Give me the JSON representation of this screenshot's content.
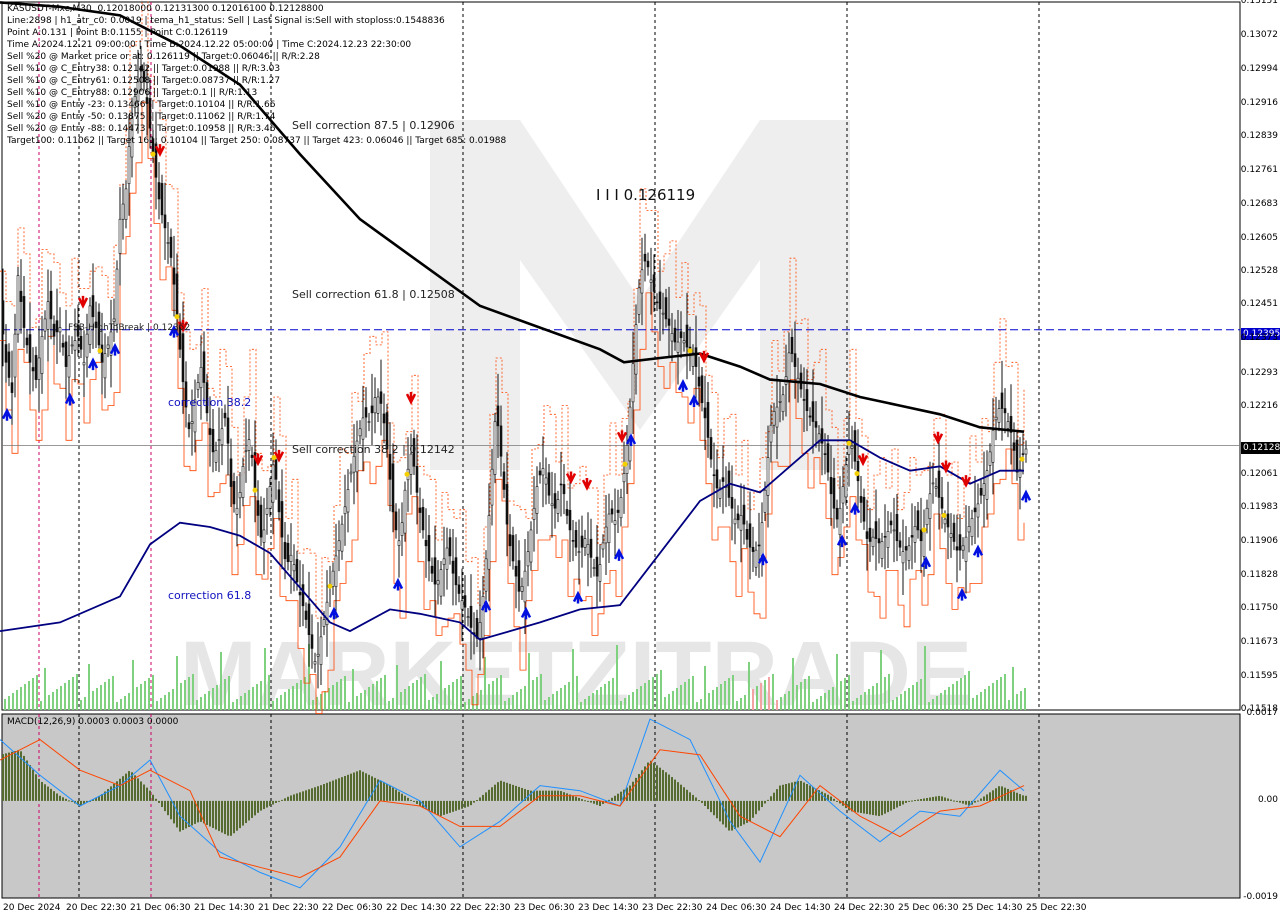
{
  "info_lines": [
    "KASUSDT-Mxc,M30  0.12018000 0.12131300 0.12016100 0.12128800",
    "Line:2898 | h1_atr_c0: 0.0019 | tema_h1_status: Sell | Last Signal is:Sell with stoploss:0.1548836",
    "Point A:0.131 | Point B:0.1155 | Point C:0.126119",
    "Time A:2024.12.21 09:00:00 | Time B:2024.12.22 05:00:00 | Time C:2024.12.23 22:30:00",
    "Sell %20 @ Market price or at: 0.126119 || Target:0.06046 || R/R:2.28",
    "Sell %10 @ C_Entry38: 0.12142 || Target:0.01988 || R/R:3.03",
    "Sell %10 @ C_Entry61: 0.12508 || Target:0.08737 || R/R:1.27",
    "Sell %10 @ C_Entry88: 0.12906 || Target:0.1 || R/R:1.13",
    "Sell %10 @ Entry -23: 0.13466 || Target:0.10104 || R/R:1.66",
    "Sell %20 @ Entry -50: 0.13875 || Target:0.11062 || R/R:1.74",
    "Sell %20 @ Entry -88: 0.14473 || Target:0.10958 || R/R:3.46",
    "Target100: 0.11062 || Target 161: 0.10104 || Target 250: 0.08737 || Target 423: 0.06046 || Target 685: 0.01988"
  ],
  "annotations": {
    "sell_correction_875": "Sell correction 87.5 | 0.12906",
    "sell_correction_618": "Sell correction 61.8 | 0.12508",
    "sell_correction_382": "Sell correction 38.2 | 0.12142",
    "high_to_break": "FSB-HighToBreak | 0.12352",
    "correction_382": "correction 38.2",
    "correction_618": "correction 61.8",
    "point_c": "I I I 0.126119"
  },
  "price_axis": [
    "0.13151",
    "0.13072",
    "0.12994",
    "0.12916",
    "0.12839",
    "0.12761",
    "0.12683",
    "0.12605",
    "0.12528",
    "0.12451",
    "0.12373",
    "0.12293",
    "0.12216",
    "0.12061",
    "0.11983",
    "0.11906",
    "0.11828",
    "0.11750",
    "0.11673",
    "0.11595",
    "0.11518"
  ],
  "price_boxes": {
    "high_to_break": "0.12395",
    "current": "0.12128"
  },
  "macd_axis": [
    "0.0017",
    "0.00",
    "-0.0019"
  ],
  "macd_title": "MACD(12,26,9) 0.0003 0.0003 0.0000",
  "time_axis": [
    "20 Dec 2024",
    "20 Dec 22:30",
    "21 Dec 06:30",
    "21 Dec 14:30",
    "21 Dec 22:30",
    "22 Dec 06:30",
    "22 Dec 14:30",
    "22 Dec 22:30",
    "23 Dec 06:30",
    "23 Dec 14:30",
    "23 Dec 22:30",
    "24 Dec 06:30",
    "24 Dec 14:30",
    "24 Dec 22:30",
    "25 Dec 06:30",
    "25 Dec 14:30",
    "25 Dec 22:30"
  ],
  "watermark": "MARKETZITRADE",
  "colors": {
    "bull": "#1a1a1a",
    "bear": "#1a1a1a",
    "ema_long": "#000000",
    "ema_short": "#000080",
    "orange": "#ff4500",
    "macd_hist": "#556b2f",
    "macd_line": "#1e90ff",
    "signal_line": "#ff4500",
    "level_line": "#0000cd"
  },
  "chart_data": {
    "type": "candlestick",
    "symbol": "KASUSDT-Mxc",
    "timeframe": "M30",
    "ylim": [
      0.11518,
      0.13151
    ],
    "key_points_y": [
      0.131,
      0.1155,
      0.126119
    ],
    "close_path": [
      [
        0,
        0.1245
      ],
      [
        6,
        0.1232
      ],
      [
        12,
        0.1225
      ],
      [
        18,
        0.1252
      ],
      [
        24,
        0.124
      ],
      [
        30,
        0.1232
      ],
      [
        36,
        0.1228
      ],
      [
        42,
        0.1238
      ],
      [
        48,
        0.1246
      ],
      [
        54,
        0.1238
      ],
      [
        60,
        0.124
      ],
      [
        66,
        0.1231
      ],
      [
        72,
        0.1236
      ],
      [
        78,
        0.1238
      ],
      [
        84,
        0.1232
      ],
      [
        90,
        0.1245
      ],
      [
        96,
        0.124
      ],
      [
        102,
        0.1232
      ],
      [
        108,
        0.1236
      ],
      [
        114,
        0.1242
      ],
      [
        120,
        0.1265
      ],
      [
        126,
        0.1272
      ],
      [
        130,
        0.1285
      ],
      [
        136,
        0.1295
      ],
      [
        142,
        0.13
      ],
      [
        148,
        0.129
      ],
      [
        154,
        0.1278
      ],
      [
        160,
        0.1268
      ],
      [
        166,
        0.1262
      ],
      [
        172,
        0.1255
      ],
      [
        178,
        0.124
      ],
      [
        184,
        0.1225
      ],
      [
        190,
        0.1215
      ],
      [
        196,
        0.1225
      ],
      [
        202,
        0.1232
      ],
      [
        208,
        0.1218
      ],
      [
        214,
        0.121
      ],
      [
        220,
        0.1215
      ],
      [
        226,
        0.122
      ],
      [
        232,
        0.12
      ],
      [
        238,
        0.1198
      ],
      [
        244,
        0.121
      ],
      [
        250,
        0.1215
      ],
      [
        256,
        0.12
      ],
      [
        262,
        0.119
      ],
      [
        268,
        0.12
      ],
      [
        274,
        0.121
      ],
      [
        280,
        0.1195
      ],
      [
        286,
        0.1185
      ],
      [
        292,
        0.1188
      ],
      [
        298,
        0.118
      ],
      [
        304,
        0.1175
      ],
      [
        310,
        0.1168
      ],
      [
        316,
        0.1162
      ],
      [
        322,
        0.117
      ],
      [
        328,
        0.1178
      ],
      [
        334,
        0.1185
      ],
      [
        340,
        0.1192
      ],
      [
        346,
        0.12
      ],
      [
        352,
        0.1208
      ],
      [
        358,
        0.1215
      ],
      [
        364,
        0.122
      ],
      [
        370,
        0.1218
      ],
      [
        376,
        0.1225
      ],
      [
        382,
        0.1222
      ],
      [
        388,
        0.121
      ],
      [
        394,
        0.1195
      ],
      [
        400,
        0.119
      ],
      [
        406,
        0.1205
      ],
      [
        412,
        0.1212
      ],
      [
        418,
        0.12
      ],
      [
        424,
        0.1192
      ],
      [
        430,
        0.1185
      ],
      [
        436,
        0.118
      ],
      [
        442,
        0.1185
      ],
      [
        448,
        0.119
      ],
      [
        454,
        0.1182
      ],
      [
        460,
        0.1178
      ],
      [
        466,
        0.1175
      ],
      [
        472,
        0.117
      ],
      [
        478,
        0.1168
      ],
      [
        484,
        0.118
      ],
      [
        490,
        0.12
      ],
      [
        496,
        0.1222
      ],
      [
        502,
        0.1208
      ],
      [
        508,
        0.1192
      ],
      [
        514,
        0.1185
      ],
      [
        520,
        0.1178
      ],
      [
        526,
        0.1185
      ],
      [
        532,
        0.1195
      ],
      [
        538,
        0.1205
      ],
      [
        544,
        0.1208
      ],
      [
        550,
        0.12
      ],
      [
        556,
        0.1198
      ],
      [
        562,
        0.1205
      ],
      [
        568,
        0.1195
      ],
      [
        574,
        0.119
      ],
      [
        580,
        0.1188
      ],
      [
        586,
        0.1192
      ],
      [
        592,
        0.1186
      ],
      [
        598,
        0.1182
      ],
      [
        604,
        0.1192
      ],
      [
        610,
        0.1198
      ],
      [
        616,
        0.1195
      ],
      [
        622,
        0.1202
      ],
      [
        628,
        0.1215
      ],
      [
        634,
        0.1235
      ],
      [
        640,
        0.1252
      ],
      [
        646,
        0.1256
      ],
      [
        652,
        0.125
      ],
      [
        658,
        0.1245
      ],
      [
        664,
        0.1243
      ],
      [
        670,
        0.124
      ],
      [
        676,
        0.1236
      ],
      [
        682,
        0.1238
      ],
      [
        688,
        0.1235
      ],
      [
        694,
        0.1234
      ],
      [
        700,
        0.1225
      ],
      [
        706,
        0.1218
      ],
      [
        712,
        0.1208
      ],
      [
        718,
        0.1202
      ],
      [
        724,
        0.1205
      ],
      [
        730,
        0.12
      ],
      [
        736,
        0.1195
      ],
      [
        742,
        0.1197
      ],
      [
        748,
        0.119
      ],
      [
        754,
        0.1188
      ],
      [
        760,
        0.119
      ],
      [
        766,
        0.1205
      ],
      [
        772,
        0.122
      ],
      [
        778,
        0.1222
      ],
      [
        784,
        0.1225
      ],
      [
        790,
        0.1236
      ],
      [
        796,
        0.123
      ],
      [
        802,
        0.1225
      ],
      [
        808,
        0.122
      ],
      [
        814,
        0.1218
      ],
      [
        820,
        0.1215
      ],
      [
        826,
        0.121
      ],
      [
        832,
        0.12
      ],
      [
        838,
        0.1195
      ],
      [
        844,
        0.1205
      ],
      [
        850,
        0.1215
      ],
      [
        856,
        0.1208
      ],
      [
        862,
        0.1198
      ],
      [
        868,
        0.119
      ],
      [
        874,
        0.1192
      ],
      [
        880,
        0.119
      ],
      [
        886,
        0.1192
      ],
      [
        892,
        0.1195
      ],
      [
        898,
        0.119
      ],
      [
        904,
        0.1188
      ],
      [
        910,
        0.119
      ],
      [
        916,
        0.1195
      ],
      [
        922,
        0.119
      ],
      [
        928,
        0.12
      ],
      [
        934,
        0.1205
      ],
      [
        940,
        0.12
      ],
      [
        946,
        0.1195
      ],
      [
        952,
        0.1192
      ],
      [
        958,
        0.1188
      ],
      [
        964,
        0.119
      ],
      [
        970,
        0.1195
      ],
      [
        976,
        0.1198
      ],
      [
        982,
        0.1202
      ],
      [
        988,
        0.1208
      ],
      [
        994,
        0.1218
      ],
      [
        1000,
        0.1222
      ],
      [
        1006,
        0.122
      ],
      [
        1012,
        0.1215
      ],
      [
        1018,
        0.1205
      ],
      [
        1024,
        0.1212
      ]
    ],
    "ema_long": [
      [
        0,
        0.1315
      ],
      [
        60,
        0.1314
      ],
      [
        120,
        0.1312
      ],
      [
        180,
        0.1305
      ],
      [
        240,
        0.1296
      ],
      [
        300,
        0.128
      ],
      [
        360,
        0.1265
      ],
      [
        420,
        0.1255
      ],
      [
        480,
        0.1245
      ],
      [
        540,
        0.124
      ],
      [
        600,
        0.1235
      ],
      [
        624,
        0.1232
      ],
      [
        660,
        0.1233
      ],
      [
        700,
        0.1234
      ],
      [
        740,
        0.1231
      ],
      [
        770,
        0.1228
      ],
      [
        820,
        0.1227
      ],
      [
        860,
        0.1224
      ],
      [
        900,
        0.1222
      ],
      [
        940,
        0.122
      ],
      [
        980,
        0.1217
      ],
      [
        1024,
        0.1216
      ]
    ],
    "ema_short": [
      [
        0,
        0.117
      ],
      [
        60,
        0.1172
      ],
      [
        120,
        0.1178
      ],
      [
        150,
        0.119
      ],
      [
        180,
        0.1195
      ],
      [
        210,
        0.1194
      ],
      [
        240,
        0.1192
      ],
      [
        270,
        0.1188
      ],
      [
        300,
        0.118
      ],
      [
        330,
        0.1172
      ],
      [
        350,
        0.117
      ],
      [
        390,
        0.1175
      ],
      [
        420,
        0.1174
      ],
      [
        460,
        0.1172
      ],
      [
        480,
        0.1168
      ],
      [
        510,
        0.117
      ],
      [
        540,
        0.1172
      ],
      [
        580,
        0.1175
      ],
      [
        620,
        0.1176
      ],
      [
        660,
        0.1188
      ],
      [
        700,
        0.12
      ],
      [
        730,
        0.1204
      ],
      [
        760,
        0.1202
      ],
      [
        790,
        0.1208
      ],
      [
        820,
        0.1214
      ],
      [
        850,
        0.1214
      ],
      [
        880,
        0.121
      ],
      [
        910,
        0.1207
      ],
      [
        940,
        0.1208
      ],
      [
        970,
        0.1204
      ],
      [
        1000,
        0.1207
      ],
      [
        1024,
        0.1207
      ]
    ],
    "high_to_break": 0.12395,
    "current_price": 0.12128,
    "sell_correction_levels": [
      0.12906,
      0.12508,
      0.12142
    ],
    "macd": {
      "range": [
        -0.0019,
        0.0017
      ],
      "histogram": [
        [
          0,
          0.0009
        ],
        [
          20,
          0.001
        ],
        [
          40,
          0.0004
        ],
        [
          60,
          0.0001
        ],
        [
          80,
          -0.0001
        ],
        [
          100,
          0.0001
        ],
        [
          130,
          0.0006
        ],
        [
          150,
          0.0002
        ],
        [
          180,
          -0.0006
        ],
        [
          200,
          -0.0004
        ],
        [
          230,
          -0.0007
        ],
        [
          260,
          -0.0002
        ],
        [
          290,
          0.0001
        ],
        [
          320,
          0.0003
        ],
        [
          360,
          0.0006
        ],
        [
          390,
          0.0003
        ],
        [
          420,
          -0.0001
        ],
        [
          440,
          -0.0003
        ],
        [
          470,
          -0.0001
        ],
        [
          500,
          0.0004
        ],
        [
          530,
          0.0002
        ],
        [
          560,
          0.0002
        ],
        [
          600,
          -0.0001
        ],
        [
          630,
          0.0003
        ],
        [
          650,
          0.0008
        ],
        [
          670,
          0.0005
        ],
        [
          700,
          0.0
        ],
        [
          730,
          -0.0006
        ],
        [
          750,
          -0.0004
        ],
        [
          780,
          0.0003
        ],
        [
          800,
          0.0004
        ],
        [
          830,
          0.0001
        ],
        [
          850,
          -0.0002
        ],
        [
          880,
          -0.0003
        ],
        [
          910,
          0.0
        ],
        [
          940,
          0.0001
        ],
        [
          970,
          -0.0001
        ],
        [
          1000,
          0.0003
        ],
        [
          1024,
          0.0001
        ]
      ],
      "macd_line": [
        [
          0,
          0.0012
        ],
        [
          40,
          0.0005
        ],
        [
          80,
          -0.0001
        ],
        [
          120,
          0.0003
        ],
        [
          150,
          0.0008
        ],
        [
          180,
          -0.0003
        ],
        [
          220,
          -0.001
        ],
        [
          260,
          -0.0014
        ],
        [
          300,
          -0.0017
        ],
        [
          340,
          -0.0009
        ],
        [
          380,
          0.0004
        ],
        [
          420,
          0.0
        ],
        [
          460,
          -0.0009
        ],
        [
          500,
          -0.0004
        ],
        [
          540,
          0.0003
        ],
        [
          580,
          0.0002
        ],
        [
          620,
          -0.0001
        ],
        [
          650,
          0.0016
        ],
        [
          690,
          0.0012
        ],
        [
          730,
          -0.0004
        ],
        [
          760,
          -0.0012
        ],
        [
          800,
          0.0005
        ],
        [
          840,
          -0.0002
        ],
        [
          880,
          -0.0008
        ],
        [
          920,
          -0.0002
        ],
        [
          960,
          -0.0003
        ],
        [
          1000,
          0.0006
        ],
        [
          1024,
          0.0002
        ]
      ],
      "signal_line": [
        [
          0,
          0.0008
        ],
        [
          40,
          0.0012
        ],
        [
          80,
          0.0006
        ],
        [
          120,
          0.0003
        ],
        [
          150,
          0.0006
        ],
        [
          190,
          0.0002
        ],
        [
          220,
          -0.0011
        ],
        [
          260,
          -0.0013
        ],
        [
          300,
          -0.0015
        ],
        [
          340,
          -0.0011
        ],
        [
          380,
          0.0
        ],
        [
          420,
          -0.0001
        ],
        [
          460,
          -0.0005
        ],
        [
          500,
          -0.0005
        ],
        [
          540,
          0.0001
        ],
        [
          580,
          0.0001
        ],
        [
          620,
          -0.0001
        ],
        [
          660,
          0.001
        ],
        [
          700,
          0.0009
        ],
        [
          740,
          -0.0003
        ],
        [
          780,
          -0.0007
        ],
        [
          820,
          0.0003
        ],
        [
          860,
          -0.0003
        ],
        [
          900,
          -0.0007
        ],
        [
          940,
          -0.0002
        ],
        [
          980,
          -0.0001
        ],
        [
          1024,
          0.0003
        ]
      ]
    }
  }
}
